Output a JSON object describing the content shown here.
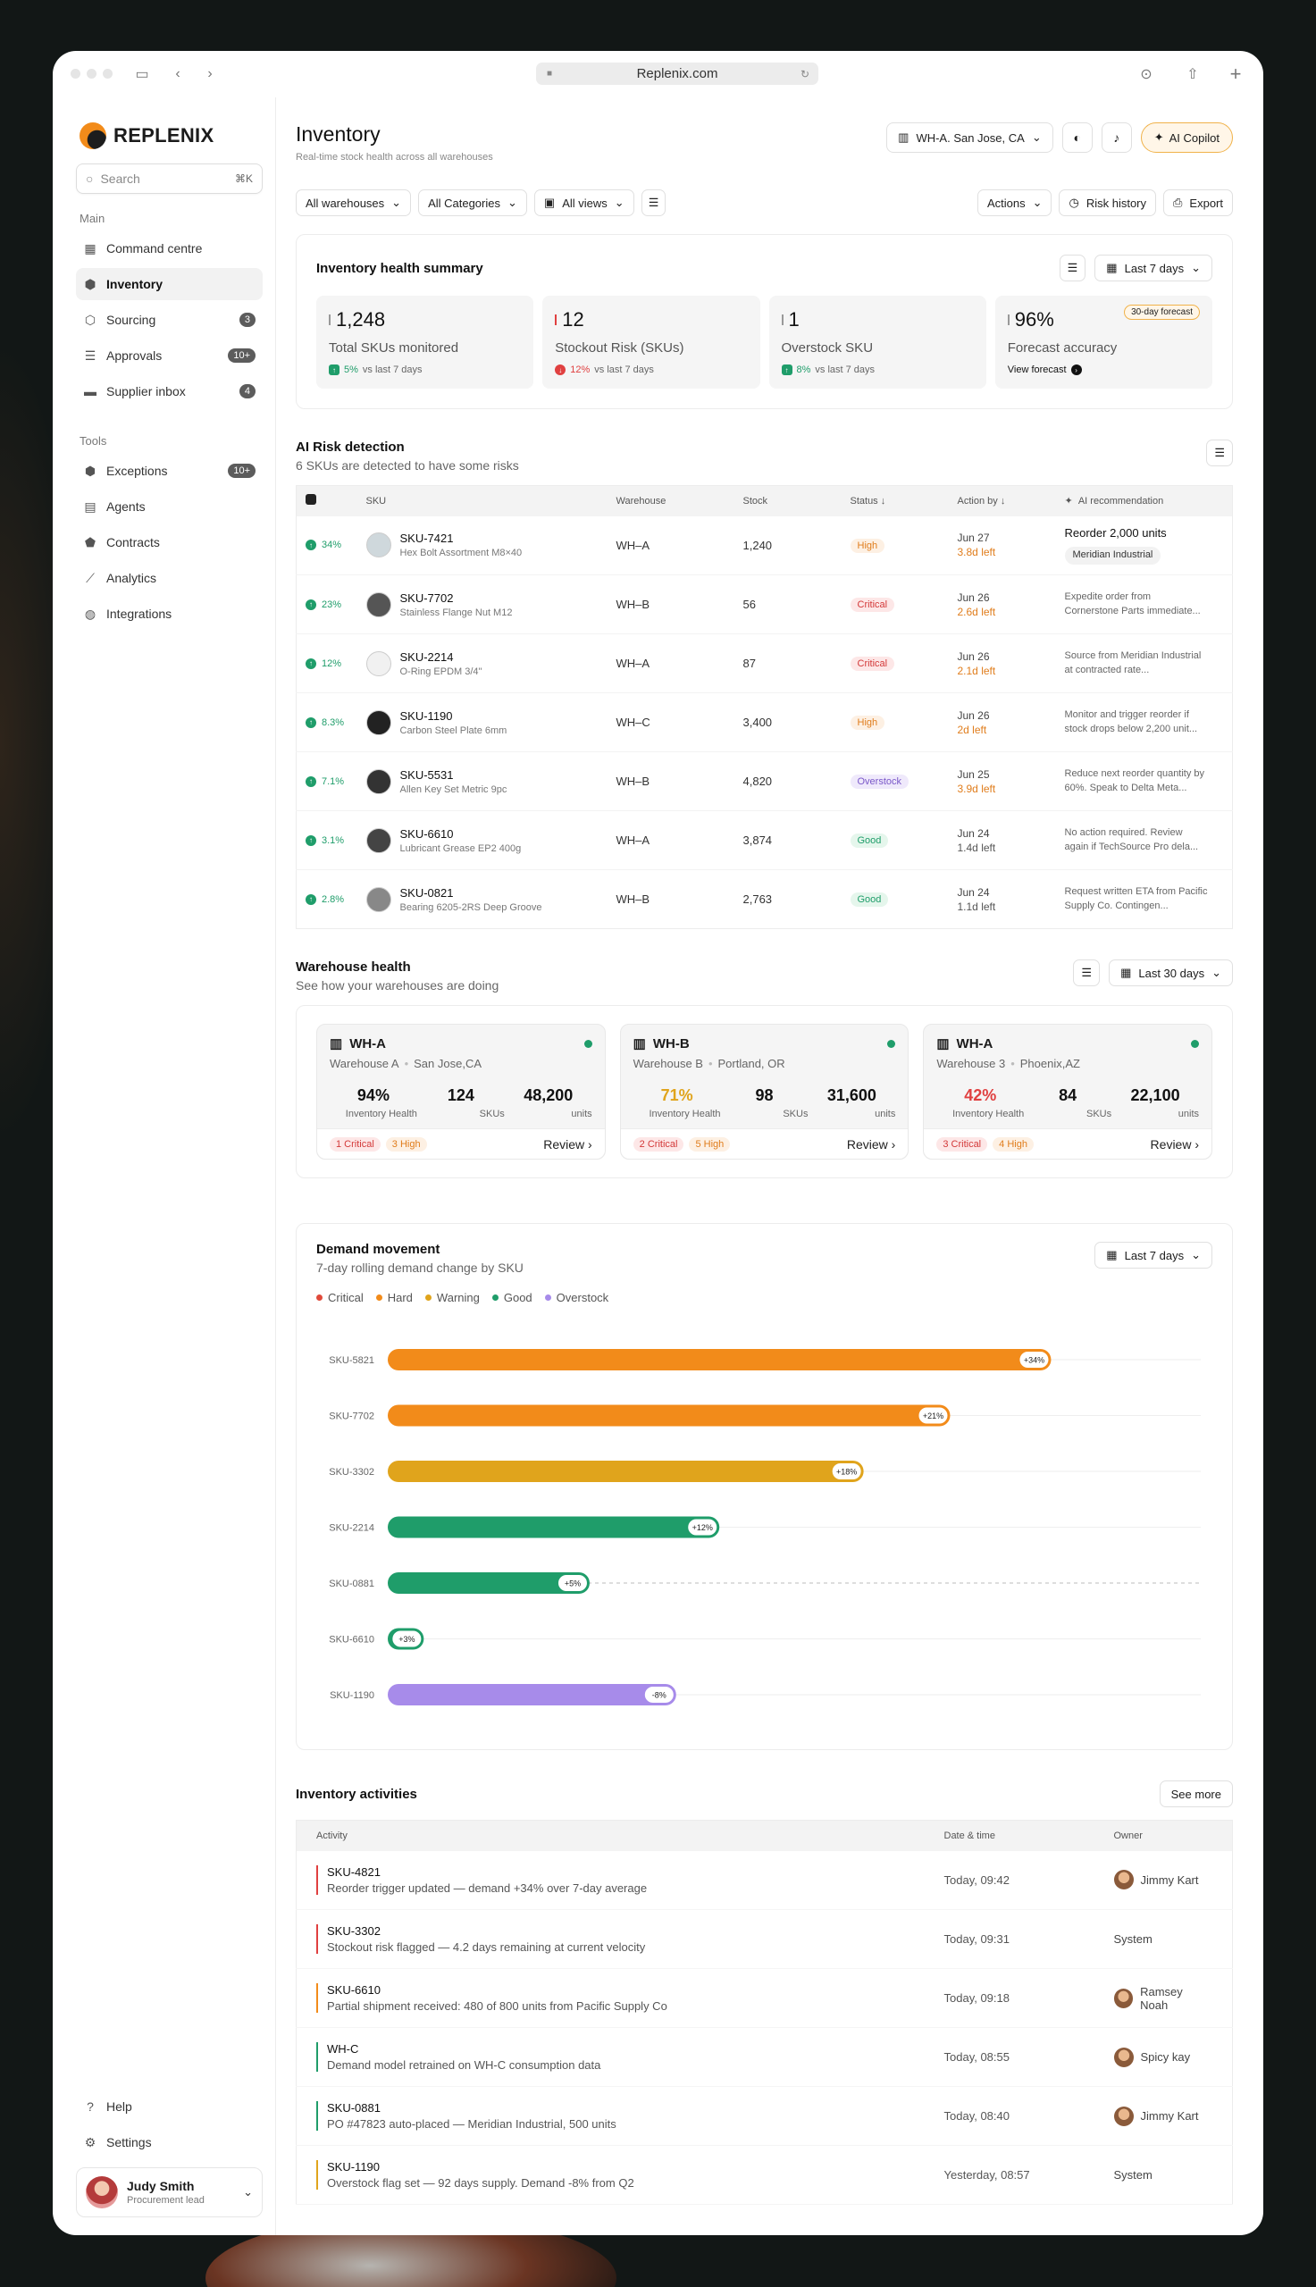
{
  "browser": {
    "url": "Replenix.com"
  },
  "brand": "REPLENIX",
  "search": {
    "placeholder": "Search",
    "shortcut": "⌘K"
  },
  "nav": {
    "main_label": "Main",
    "main": [
      {
        "label": "Command centre",
        "icon": "grid-icon"
      },
      {
        "label": "Inventory",
        "icon": "box-icon",
        "active": true
      },
      {
        "label": "Sourcing",
        "icon": "sourcing-icon",
        "badge": "3"
      },
      {
        "label": "Approvals",
        "icon": "checklist-icon",
        "badge": "10+"
      },
      {
        "label": "Supplier inbox",
        "icon": "inbox-icon",
        "badge": "4"
      }
    ],
    "tools_label": "Tools",
    "tools": [
      {
        "label": "Exceptions",
        "icon": "exception-icon",
        "badge": "10+"
      },
      {
        "label": "Agents",
        "icon": "agent-icon"
      },
      {
        "label": "Contracts",
        "icon": "contract-icon"
      },
      {
        "label": "Analytics",
        "icon": "analytics-icon"
      },
      {
        "label": "Integrations",
        "icon": "integration-icon"
      }
    ],
    "help": "Help",
    "settings": "Settings"
  },
  "user": {
    "name": "Judy Smith",
    "role": "Procurement lead"
  },
  "header": {
    "title": "Inventory",
    "subtitle": "Real-time stock health across all warehouses",
    "warehouse": "WH-A. San Jose, CA",
    "copilot": "AI Copilot"
  },
  "filters": {
    "warehouses": "All warehouses",
    "categories": "All Categories",
    "views": "All views",
    "actions": "Actions",
    "risk_history": "Risk history",
    "export": "Export"
  },
  "health": {
    "title": "Inventory health summary",
    "range": "Last 7 days",
    "stats": [
      {
        "value": "1,248",
        "label": "Total SKUs monitored",
        "delta": "5%",
        "note": "vs last 7 days",
        "dir": "up"
      },
      {
        "value": "12",
        "label": "Stockout Risk (SKUs)",
        "delta": "12%",
        "note": "vs last 7 days",
        "dir": "dn"
      },
      {
        "value": "1",
        "label": "Overstock SKU",
        "delta": "8%",
        "note": "vs last 7 days",
        "dir": "up"
      },
      {
        "value": "96%",
        "label": "Forecast accuracy",
        "link": "View forecast",
        "tag": "30-day forecast"
      }
    ]
  },
  "risk": {
    "title": "AI Risk detection",
    "subtitle": "6 SKUs are detected to have some risks",
    "headers": {
      "sku": "SKU",
      "warehouse": "Warehouse",
      "stock": "Stock",
      "status": "Status",
      "action": "Action by",
      "rec": "AI recommendation"
    },
    "rows": [
      {
        "pct": "34%",
        "sku": "SKU-7421",
        "desc": "Hex Bolt Assortment M8×40",
        "wh": "WH–A",
        "stock": "1,240",
        "status": "High",
        "date": "Jun 27",
        "left": "3.8d left",
        "rec": "Reorder 2,000 units",
        "rec_sub": "Meridian Industrial"
      },
      {
        "pct": "23%",
        "sku": "SKU-7702",
        "desc": "Stainless Flange Nut M12",
        "wh": "WH–B",
        "stock": "56",
        "status": "Critical",
        "date": "Jun 26",
        "left": "2.6d left",
        "rec": "Expedite order from Cornerstone Parts immediate..."
      },
      {
        "pct": "12%",
        "sku": "SKU-2214",
        "desc": "O-Ring EPDM 3/4\"",
        "wh": "WH–A",
        "stock": "87",
        "status": "Critical",
        "date": "Jun 26",
        "left": "2.1d left",
        "rec": "Source from Meridian Industrial at contracted rate..."
      },
      {
        "pct": "8.3%",
        "sku": "SKU-1190",
        "desc": "Carbon Steel Plate 6mm",
        "wh": "WH–C",
        "stock": "3,400",
        "status": "High",
        "date": "Jun 26",
        "left": "2d left",
        "rec": "Monitor and trigger reorder if stock drops below 2,200 unit..."
      },
      {
        "pct": "7.1%",
        "sku": "SKU-5531",
        "desc": "Allen Key Set Metric 9pc",
        "wh": "WH–B",
        "stock": "4,820",
        "status": "Overstock",
        "date": "Jun 25",
        "left": "3.9d left",
        "rec": "Reduce next reorder quantity by 60%. Speak to Delta Meta..."
      },
      {
        "pct": "3.1%",
        "sku": "SKU-6610",
        "desc": "Lubricant Grease EP2 400g",
        "wh": "WH–A",
        "stock": "3,874",
        "status": "Good",
        "date": "Jun 24",
        "left": "1.4d left",
        "rec": "No action required. Review again if TechSource Pro dela..."
      },
      {
        "pct": "2.8%",
        "sku": "SKU-0821",
        "desc": "Bearing 6205-2RS Deep Groove",
        "wh": "WH–B",
        "stock": "2,763",
        "status": "Good",
        "date": "Jun 24",
        "left": "1.1d left",
        "rec": "Request written ETA from Pacific Supply Co. Contingen..."
      }
    ]
  },
  "warehouse": {
    "title": "Warehouse health",
    "subtitle": "See how your warehouses are doing",
    "range": "Last 30 days",
    "cards": [
      {
        "code": "WH-A",
        "name": "Warehouse A",
        "loc": "San Jose,CA",
        "health": "94%",
        "skus": "124",
        "units": "48,200",
        "crit": "1 Critical",
        "high": "3 High",
        "review": "Review",
        "hcolor": "#111"
      },
      {
        "code": "WH-B",
        "name": "Warehouse B",
        "loc": "Portland, OR",
        "health": "71%",
        "skus": "98",
        "units": "31,600",
        "crit": "2 Critical",
        "high": "5 High",
        "review": "Review",
        "hcolor": "#e0a41c"
      },
      {
        "code": "WH-A",
        "name": "Warehouse 3",
        "loc": "Phoenix,AZ",
        "health": "42%",
        "skus": "84",
        "units": "22,100",
        "crit": "3 Critical",
        "high": "4 High",
        "review": "Review",
        "hcolor": "#e04040"
      }
    ],
    "labels": {
      "health": "Inventory Health",
      "skus": "SKUs",
      "units": "units"
    }
  },
  "demand": {
    "title": "Demand movement",
    "subtitle": "7-day rolling demand change by SKU",
    "range": "Last 7 days"
  },
  "chart_data": {
    "type": "bar",
    "orientation": "horizontal",
    "categories": [
      "SKU-5821",
      "SKU-7702",
      "SKU-3302",
      "SKU-2214",
      "SKU-0881",
      "SKU-6610",
      "SKU-1190"
    ],
    "values": [
      92,
      78,
      66,
      46,
      28,
      5,
      40
    ],
    "labels": [
      "+34%",
      "+21%",
      "+18%",
      "+12%",
      "+5%",
      "+3%",
      "-8%"
    ],
    "status": [
      "Hard",
      "Hard",
      "Warning",
      "Good",
      "Good",
      "Good",
      "Overstock"
    ],
    "legend": [
      {
        "name": "Critical",
        "color": "#e04a3a"
      },
      {
        "name": "Hard",
        "color": "#f28b1a"
      },
      {
        "name": "Warning",
        "color": "#e0a41c"
      },
      {
        "name": "Good",
        "color": "#1f9d6a"
      },
      {
        "name": "Overstock",
        "color": "#a78bea"
      }
    ],
    "xticks": [
      0,
      20,
      40,
      60,
      80,
      100
    ],
    "xlim": [
      0,
      114
    ],
    "grid": false
  },
  "activities": {
    "title": "Inventory activities",
    "see_more": "See more",
    "headers": {
      "activity": "Activity",
      "date": "Date & time",
      "owner": "Owner"
    },
    "rows": [
      {
        "title": "SKU-4821",
        "desc": "Reorder trigger updated — demand +34% over 7-day average",
        "date": "Today, 09:42",
        "owner": "Jimmy Kart",
        "color": "#e04040",
        "avatar": true
      },
      {
        "title": "SKU-3302",
        "desc": "Stockout risk flagged — 4.2 days remaining at current velocity",
        "date": "Today, 09:31",
        "owner": "System",
        "color": "#e04040",
        "avatar": false
      },
      {
        "title": "SKU-6610",
        "desc": "Partial shipment received: 480 of 800 units from Pacific Supply Co",
        "date": "Today, 09:18",
        "owner": "Ramsey Noah",
        "color": "#f28b1a",
        "avatar": true
      },
      {
        "title": "WH-C",
        "desc": "Demand model retrained on WH-C consumption data",
        "date": "Today, 08:55",
        "owner": "Spicy kay",
        "color": "#1f9d6a",
        "avatar": true
      },
      {
        "title": "SKU-0881",
        "desc": "PO #47823 auto-placed — Meridian Industrial, 500 units",
        "date": "Today, 08:40",
        "owner": "Jimmy Kart",
        "color": "#1f9d6a",
        "avatar": true
      },
      {
        "title": "SKU-1190",
        "desc": "Overstock flag set — 92 days supply. Demand -8% from Q2",
        "date": "Yesterday, 08:57",
        "owner": "System",
        "color": "#e0a41c",
        "avatar": false
      }
    ]
  }
}
